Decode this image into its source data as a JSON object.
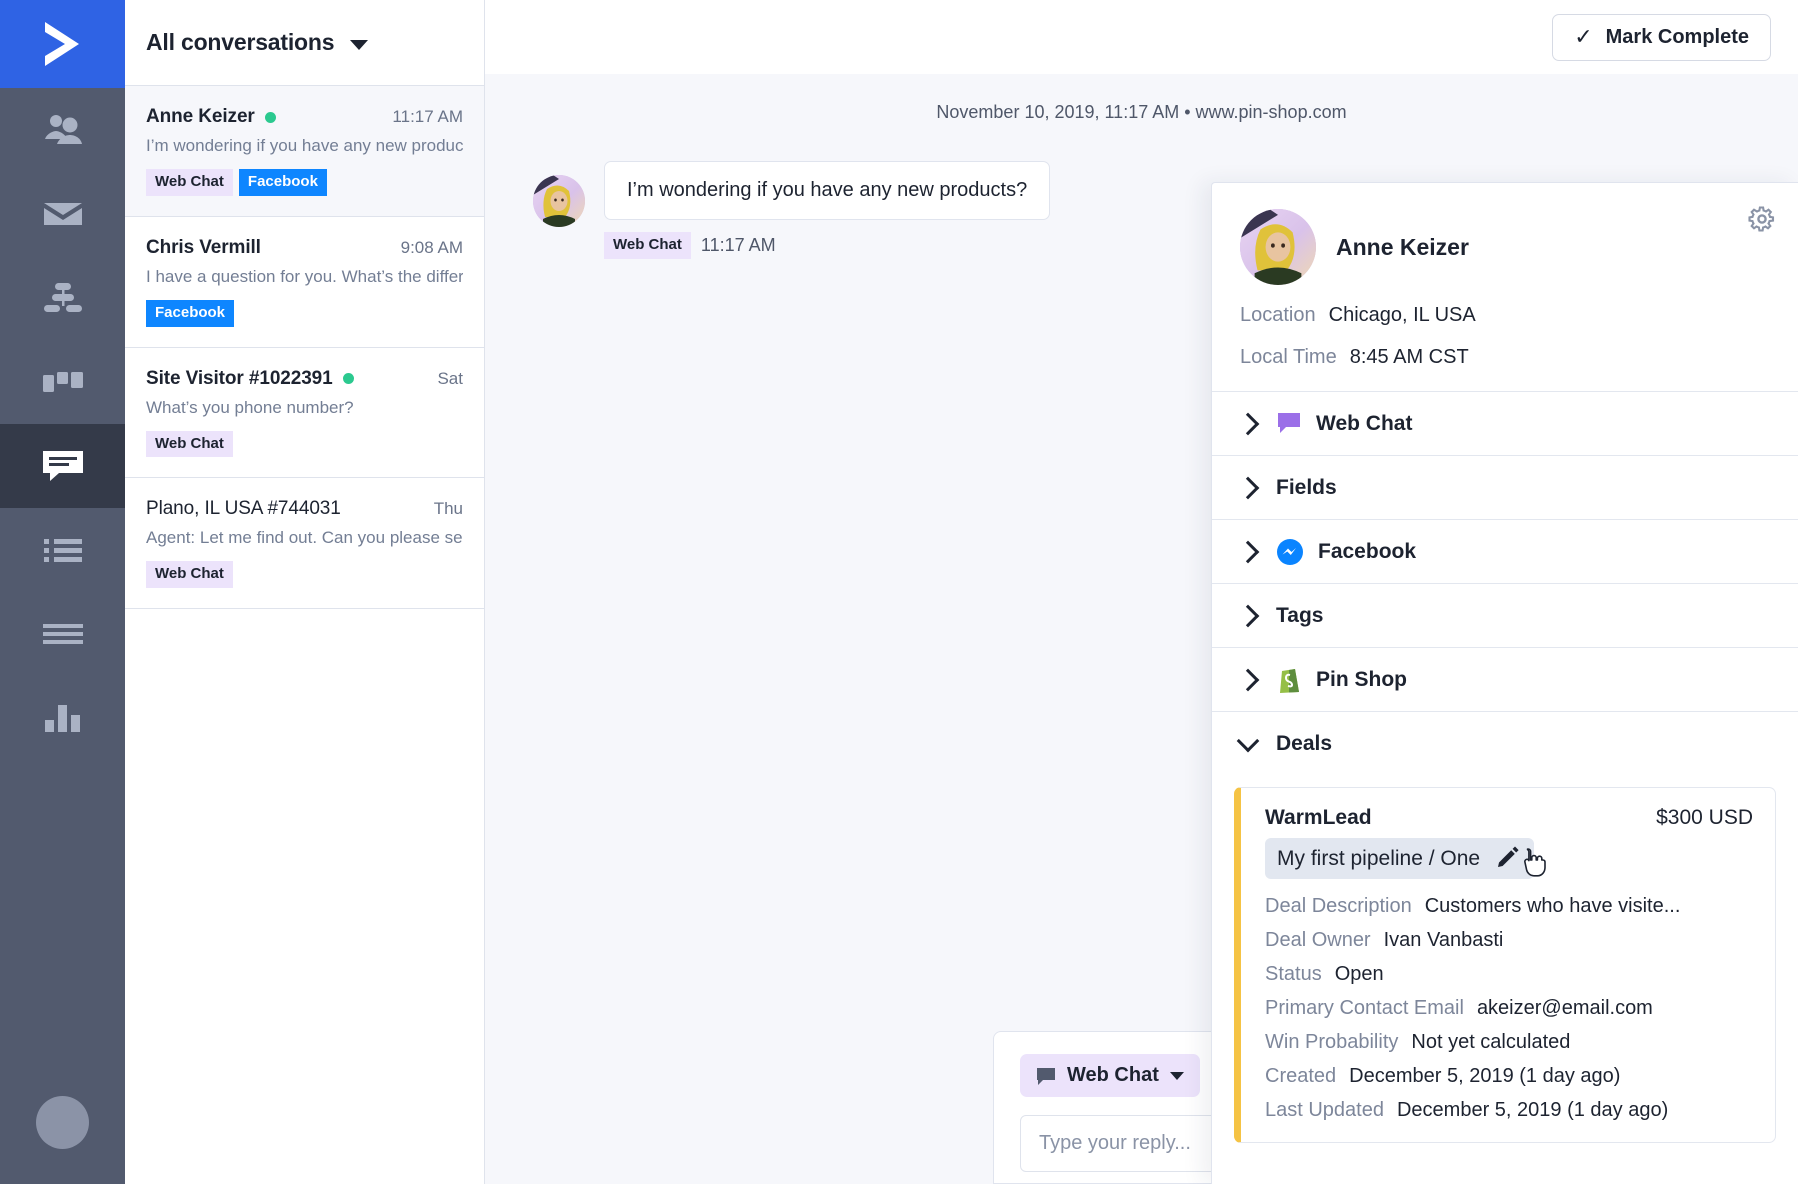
{
  "brand": {
    "logo_icon": "activecampaign-chevron-logo",
    "primary_color": "#2f63e4",
    "rail_color": "#525a6e",
    "rail_active_color": "#343a49"
  },
  "rail": {
    "items": [
      {
        "icon": "contacts-people-icon",
        "name": "contacts",
        "active": false
      },
      {
        "icon": "envelope-mail-icon",
        "name": "campaigns",
        "active": false
      },
      {
        "icon": "automations-flow-icon",
        "name": "automations",
        "active": false
      },
      {
        "icon": "deals-pipeline-icon",
        "name": "deals",
        "active": false
      },
      {
        "icon": "conversations-chat-icon",
        "name": "conversations",
        "active": true
      },
      {
        "icon": "lists-bullet-icon",
        "name": "lists",
        "active": false
      },
      {
        "icon": "forms-lines-icon",
        "name": "forms",
        "active": false
      },
      {
        "icon": "reports-bar-chart-icon",
        "name": "reports",
        "active": false
      }
    ],
    "avatar_icon": "user-avatar-placeholder"
  },
  "conversation_list": {
    "filter_label": "All conversations",
    "filter_caret_icon": "chevron-down-icon",
    "conversations": [
      {
        "name": "Anne Keizer",
        "online": true,
        "time": "11:17 AM",
        "preview": "I’m wondering if you have any new produc...",
        "tags": [
          "Web Chat",
          "Facebook"
        ],
        "selected": true,
        "bold_name": true
      },
      {
        "name": "Chris Vermill",
        "online": false,
        "time": "9:08 AM",
        "preview": "I have a question for you. What’s the differ...",
        "tags": [
          "Facebook"
        ],
        "selected": false,
        "bold_name": true
      },
      {
        "name": "Site Visitor #1022391",
        "online": true,
        "time": "Sat",
        "preview": "What’s you phone number?",
        "tags": [
          "Web Chat"
        ],
        "selected": false,
        "bold_name": true
      },
      {
        "name": "Plano, IL USA #744031",
        "online": false,
        "time": "Thu",
        "preview": "Agent: Let me find out. Can you please se ...",
        "tags": [
          "Web Chat"
        ],
        "selected": false,
        "bold_name": false
      }
    ]
  },
  "topbar": {
    "mark_complete_label": "Mark Complete",
    "check_icon": "check-icon"
  },
  "thread": {
    "date_header": "November 10, 2019, 11:17 AM • www.pin-shop.com",
    "messages": [
      {
        "text": "I’m wondering if you have any new products?",
        "channel": "Web Chat",
        "time": "11:17 AM",
        "avatar_icon": "anne-keizer-avatar"
      }
    ]
  },
  "composer": {
    "channel_label": "Web Chat",
    "channel_icon": "chat-bubble-icon",
    "caret_icon": "chevron-down-icon",
    "template_icon": "saved-response-icon",
    "reply_placeholder": "Type your reply...",
    "reply_value": ""
  },
  "details": {
    "gear_icon": "gear-icon",
    "contact": {
      "avatar_icon": "anne-keizer-avatar",
      "name": "Anne Keizer",
      "fields": [
        {
          "key": "Location",
          "value": "Chicago, IL USA"
        },
        {
          "key": "Local Time",
          "value": "8:45 AM CST"
        }
      ]
    },
    "sections": [
      {
        "label": "Web Chat",
        "icon": "web-chat-bubble-icon",
        "expanded": false
      },
      {
        "label": "Fields",
        "icon": null,
        "expanded": false
      },
      {
        "label": "Facebook",
        "icon": "facebook-messenger-icon",
        "expanded": false
      },
      {
        "label": "Tags",
        "icon": null,
        "expanded": false
      },
      {
        "label": "Pin Shop",
        "icon": "shopify-bag-icon",
        "expanded": false
      },
      {
        "label": "Deals",
        "icon": null,
        "expanded": true
      }
    ],
    "deals": [
      {
        "title": "WarmLead",
        "amount": "$300 USD",
        "pipeline": "My first pipeline / One",
        "edit_icon": "pencil-edit-icon",
        "cursor_icon": "pointer-hand-cursor",
        "accent_color": "#f5c344",
        "fields": [
          {
            "key": "Deal Description",
            "value": "Customers who have visite..."
          },
          {
            "key": "Deal Owner",
            "value": "Ivan Vanbasti"
          },
          {
            "key": "Status",
            "value": "Open"
          },
          {
            "key": "Primary Contact Email",
            "value": "akeizer@email.com"
          },
          {
            "key": "Win Probability",
            "value": "Not yet calculated"
          },
          {
            "key": "Created",
            "value": "December 5, 2019 (1 day ago)"
          },
          {
            "key": "Last Updated",
            "value": "December 5, 2019 (1 day ago)"
          }
        ]
      }
    ]
  }
}
